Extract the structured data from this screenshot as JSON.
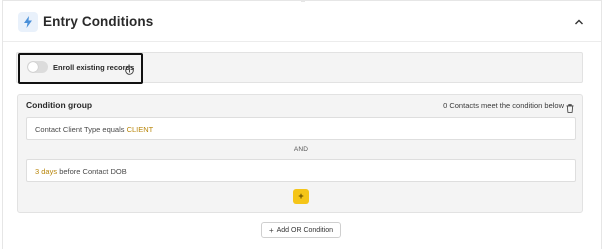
{
  "header": {
    "title": "Entry Conditions",
    "icon": "lightning-icon",
    "collapse_icon": "chevron-up-icon"
  },
  "enroll": {
    "label": "Enroll existing records",
    "toggle_on": false,
    "info_icon": "info-icon"
  },
  "condition_group": {
    "title": "Condition group",
    "meta": "0 Contacts meet the condition below",
    "delete_icon": "trash-icon",
    "conditions": [
      {
        "prefix": "Contact Client Type equals ",
        "value": "CLIENT",
        "suffix": ""
      },
      {
        "prefix": "",
        "value": "3 days",
        "suffix": " before Contact DOB"
      }
    ],
    "joiner": "AND",
    "add_label": "+"
  },
  "add_or": {
    "plus": "+",
    "label": "Add OR Condition"
  },
  "colors": {
    "accent": "#f5c518",
    "highlight": "#b8860b",
    "icon_bg": "#e9f1fb",
    "lightning": "#4a90d9"
  }
}
